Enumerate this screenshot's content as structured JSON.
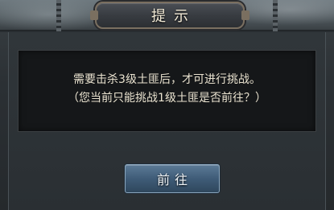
{
  "dialog": {
    "title": "提示",
    "message_line1": "需要击杀3级土匪后，才可进行挑战。",
    "message_line2": "（您当前只能挑战1级土匪是否前往？）",
    "go_button_label": "前往"
  }
}
